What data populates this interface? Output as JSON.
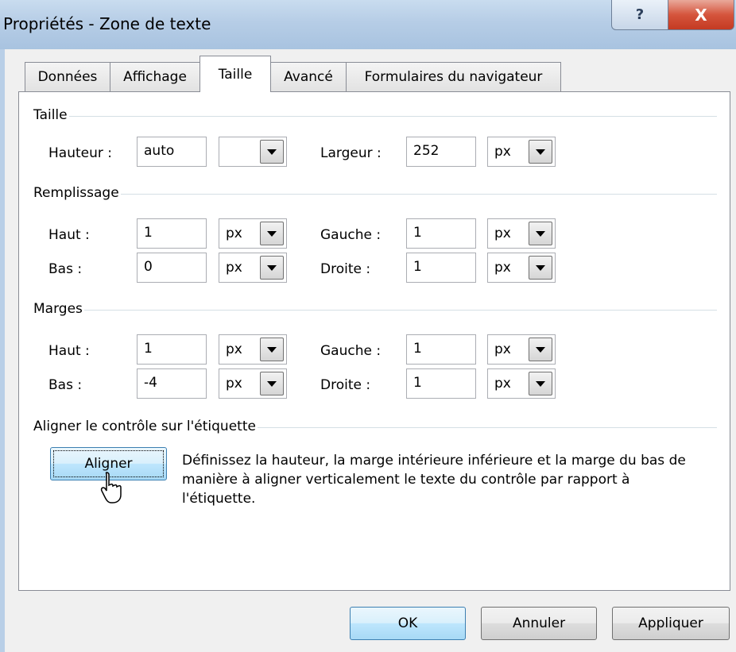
{
  "window": {
    "title": "Propriétés - Zone de texte",
    "help_glyph": "?",
    "close_glyph": "X"
  },
  "tabs": [
    {
      "label": "Données"
    },
    {
      "label": "Affichage"
    },
    {
      "label": "Taille",
      "selected": true
    },
    {
      "label": "Avancé"
    },
    {
      "label": "Formulaires du navigateur"
    }
  ],
  "size_group": {
    "title": "Taille",
    "height_label": "Hauteur :",
    "height_value": "auto",
    "height_unit": "",
    "width_label": "Largeur :",
    "width_value": "252",
    "width_unit": "px"
  },
  "padding_group": {
    "title": "Remplissage",
    "top_label": "Haut :",
    "top_value": "1",
    "top_unit": "px",
    "bottom_label": "Bas :",
    "bottom_value": "0",
    "bottom_unit": "px",
    "left_label": "Gauche :",
    "left_value": "1",
    "left_unit": "px",
    "right_label": "Droite :",
    "right_value": "1",
    "right_unit": "px"
  },
  "margins_group": {
    "title": "Marges",
    "top_label": "Haut :",
    "top_value": "1",
    "top_unit": "px",
    "bottom_label": "Bas :",
    "bottom_value": "-4",
    "bottom_unit": "px",
    "left_label": "Gauche :",
    "left_value": "1",
    "left_unit": "px",
    "right_label": "Droite :",
    "right_value": "1",
    "right_unit": "px"
  },
  "align_group": {
    "title": "Aligner le contrôle sur l'étiquette",
    "button_label": "Aligner",
    "description": "Définissez la hauteur, la marge intérieure inférieure et la marge du bas de manière à aligner verticalement le texte du contrôle par rapport à l'étiquette."
  },
  "footer": {
    "ok_label": "OK",
    "cancel_label": "Annuler",
    "apply_label": "Appliquer"
  }
}
